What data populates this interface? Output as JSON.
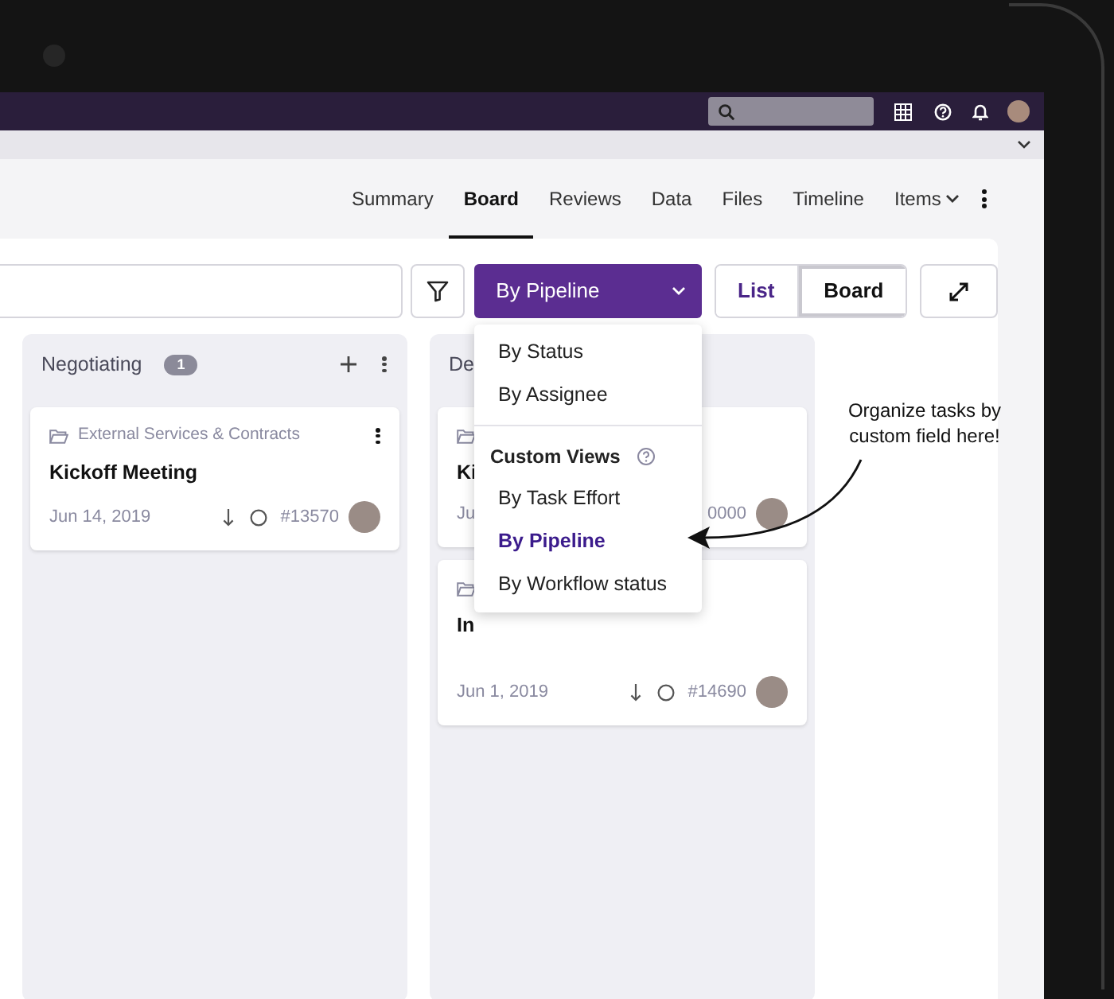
{
  "tabs": [
    {
      "label": "Summary",
      "selected": false,
      "kind": "plain"
    },
    {
      "label": "Board",
      "selected": true,
      "kind": "plain"
    },
    {
      "label": "Reviews",
      "selected": false,
      "kind": "plain"
    },
    {
      "label": "Data",
      "selected": false,
      "kind": "plain"
    },
    {
      "label": "Files",
      "selected": false,
      "kind": "plain"
    },
    {
      "label": "Timeline",
      "selected": false,
      "kind": "plain"
    },
    {
      "label": "Items",
      "selected": false,
      "kind": "dropdown"
    }
  ],
  "toolbar": {
    "view_button": "By Pipeline",
    "view_toggle": [
      {
        "label": "List",
        "selected": false
      },
      {
        "label": "Board",
        "selected": true
      }
    ]
  },
  "view_menu": {
    "items": [
      {
        "label": "By Status",
        "selected": false
      },
      {
        "label": "By Assignee",
        "selected": false
      }
    ],
    "section_title": "Custom Views",
    "custom_items": [
      {
        "label": "By Task Effort",
        "selected": false
      },
      {
        "label": "By Pipeline",
        "selected": true
      },
      {
        "label": "By Workflow status",
        "selected": false
      }
    ]
  },
  "columns": [
    {
      "title": "Negotiating",
      "count": "1",
      "cards": [
        {
          "folder": "External Services & Contracts",
          "title": "Kickoff Meeting",
          "date": "Jun 14, 2019",
          "id": "#13570"
        }
      ]
    },
    {
      "title": "De",
      "cards": [
        {
          "title": "Ki",
          "date": "Ju",
          "id": "0000"
        },
        {
          "title": "In",
          "date": "Jun 1, 2019",
          "id": "#14690"
        }
      ]
    }
  ],
  "annotation": "Organize tasks by custom field here!"
}
